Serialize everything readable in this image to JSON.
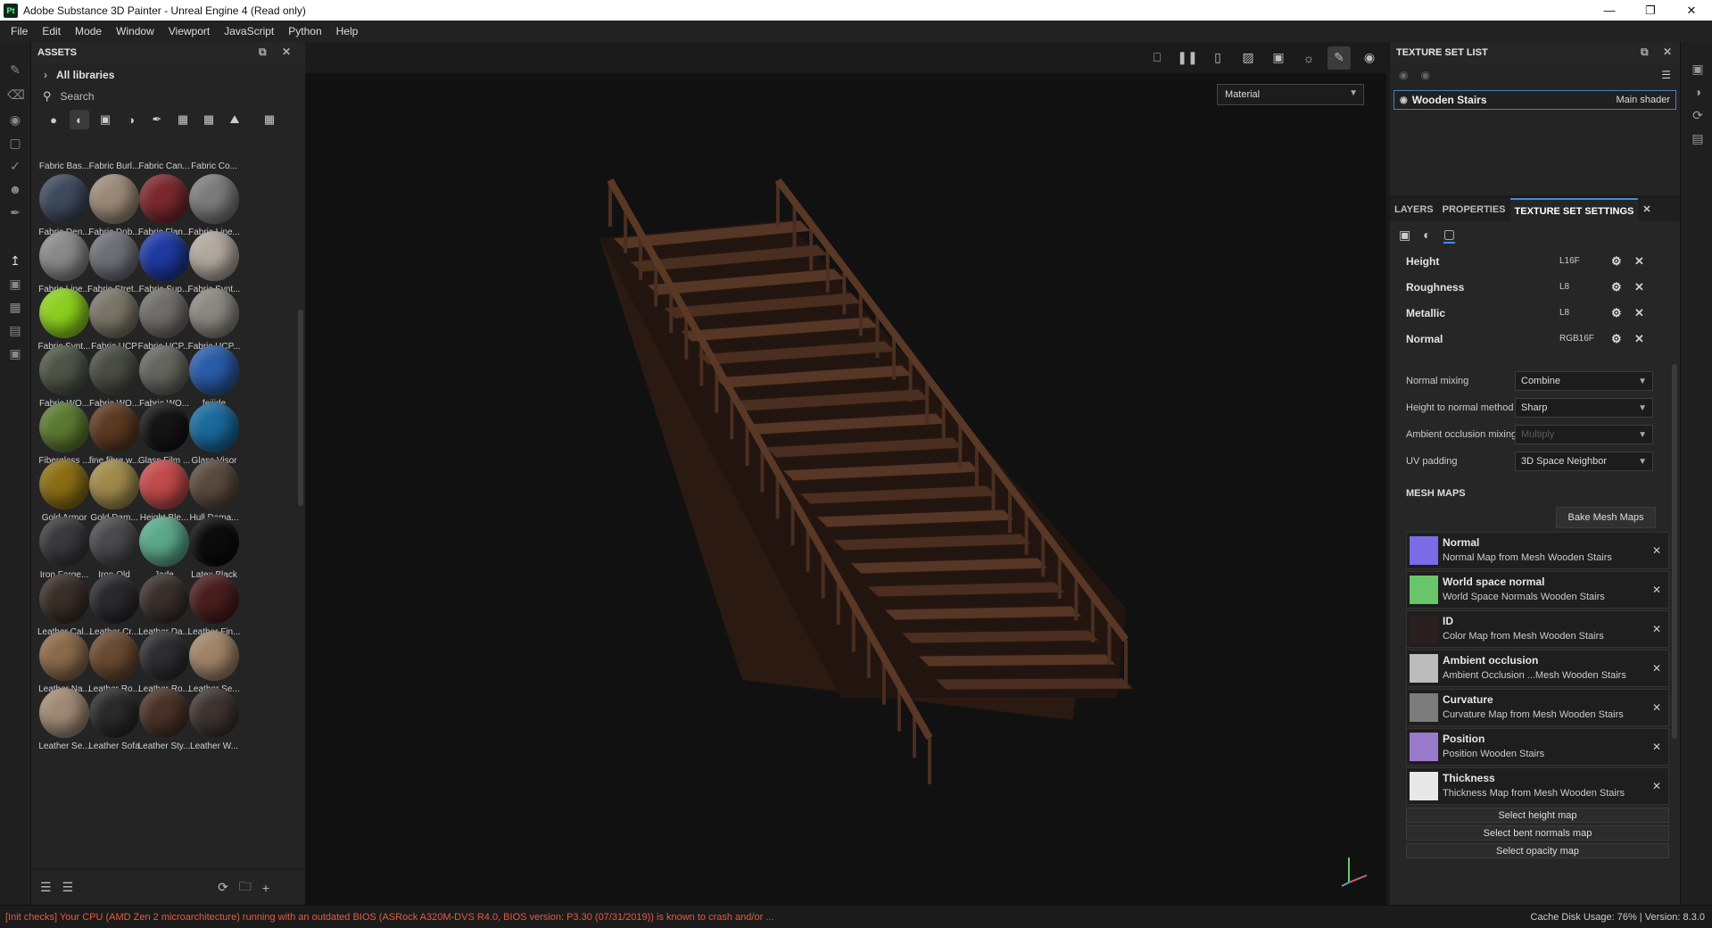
{
  "window": {
    "title": "Adobe Substance 3D Painter - Unreal Engine 4 (Read only)",
    "logo": "Pt"
  },
  "menu": [
    "File",
    "Edit",
    "Mode",
    "Window",
    "Viewport",
    "JavaScript",
    "Python",
    "Help"
  ],
  "assets": {
    "title": "ASSETS",
    "library": "All libraries",
    "search_placeholder": "Search",
    "top_labels": [
      "Fabric Bas...",
      "Fabric Burl...",
      "Fabric Can...",
      "Fabric Co..."
    ],
    "materials": [
      {
        "label": "Fabric Den...",
        "color": "#3e4a5c"
      },
      {
        "label": "Fabric Dob...",
        "color": "#9c8a78"
      },
      {
        "label": "Fabric Flan...",
        "color": "#7a2a2e"
      },
      {
        "label": "Fabric Line...",
        "color": "#7c7c7c"
      },
      {
        "label": "Fabric Line...",
        "color": "#8a8a8a"
      },
      {
        "label": "Fabric Stret...",
        "color": "#6d7078"
      },
      {
        "label": "Fabric Sup...",
        "color": "#1f3aa0"
      },
      {
        "label": "Fabric Synt...",
        "color": "#b1a89e"
      },
      {
        "label": "Fabric Synt...",
        "color": "#8ccf1e"
      },
      {
        "label": "Fabric UCP",
        "color": "#7a7568"
      },
      {
        "label": "Fabric UCP...",
        "color": "#6f6e6a"
      },
      {
        "label": "Fabric UCP...",
        "color": "#8a8880"
      },
      {
        "label": "Fabric WO...",
        "color": "#4e5648"
      },
      {
        "label": "Fabric WO...",
        "color": "#4a4d44"
      },
      {
        "label": "Fabric WO...",
        "color": "#666660"
      },
      {
        "label": "feijide",
        "color": "#2a5ca8"
      },
      {
        "label": "Fiberglass ...",
        "color": "#5c7a32"
      },
      {
        "label": "fine fibre w...",
        "color": "#5e3a22"
      },
      {
        "label": "Glass Film ...",
        "color": "#151515"
      },
      {
        "label": "Glass Visor",
        "color": "#1a6a9c"
      },
      {
        "label": "Gold Armor",
        "color": "#8a6e14"
      },
      {
        "label": "Gold Dam...",
        "color": "#a08a4a"
      },
      {
        "label": "Height Ble...",
        "color": "#c24a4a"
      },
      {
        "label": "Hull Dama...",
        "color": "#5a4a3e"
      },
      {
        "label": "Iron Forge...",
        "color": "#3a3a3c"
      },
      {
        "label": "Iron Old",
        "color": "#4a4a4c"
      },
      {
        "label": "Jade",
        "color": "#5aa88a"
      },
      {
        "label": "Latex Black",
        "color": "#0c0c0c"
      },
      {
        "label": "Leather Cal...",
        "color": "#3a2e28"
      },
      {
        "label": "Leather Cr...",
        "color": "#2a2a2c"
      },
      {
        "label": "Leather Da...",
        "color": "#3a302c"
      },
      {
        "label": "Leather Fin...",
        "color": "#4a1e1e"
      },
      {
        "label": "Leather Na...",
        "color": "#8a6a4a"
      },
      {
        "label": "Leather Ro...",
        "color": "#6a4a30"
      },
      {
        "label": "Leather Ro...",
        "color": "#2e2e30"
      },
      {
        "label": "Leather Se...",
        "color": "#a08468"
      },
      {
        "label": "Leather Se...",
        "color": "#a08a76"
      },
      {
        "label": "Leather Sofa",
        "color": "#2a2a2a"
      },
      {
        "label": "Leather Sty...",
        "color": "#4a3228"
      },
      {
        "label": "Leather W...",
        "color": "#3e3430"
      }
    ]
  },
  "viewport": {
    "mode_select": "Material"
  },
  "texture_set_list": {
    "title": "TEXTURE SET LIST",
    "set_name": "Wooden Stairs",
    "shader": "Main shader"
  },
  "tabs": [
    "LAYERS",
    "PROPERTIES",
    "TEXTURE SET SETTINGS"
  ],
  "channels": [
    {
      "name": "Height",
      "format": "L16F"
    },
    {
      "name": "Roughness",
      "format": "L8"
    },
    {
      "name": "Metallic",
      "format": "L8"
    },
    {
      "name": "Normal",
      "format": "RGB16F"
    }
  ],
  "options": [
    {
      "label": "Normal mixing",
      "value": "Combine",
      "disabled": false
    },
    {
      "label": "Height to normal method",
      "value": "Sharp",
      "disabled": false
    },
    {
      "label": "Ambient occlusion mixing",
      "value": "Multiply",
      "disabled": true
    },
    {
      "label": "UV padding",
      "value": "3D Space Neighbor",
      "disabled": false
    }
  ],
  "mesh_maps": {
    "title": "MESH MAPS",
    "bake_button": "Bake Mesh Maps",
    "items": [
      {
        "name": "Normal",
        "desc": "Normal Map from Mesh Wooden Stairs",
        "color": "#7a6ce8"
      },
      {
        "name": "World space normal",
        "desc": "World Space Normals Wooden Stairs",
        "color": "#6ac46a"
      },
      {
        "name": "ID",
        "desc": "Color Map from Mesh Wooden Stairs",
        "color": "#2a2020"
      },
      {
        "name": "Ambient occlusion",
        "desc": "Ambient Occlusion ...Mesh Wooden Stairs",
        "color": "#bcbcbc"
      },
      {
        "name": "Curvature",
        "desc": "Curvature Map from Mesh Wooden Stairs",
        "color": "#7c7c7c"
      },
      {
        "name": "Position",
        "desc": "Position Wooden Stairs",
        "color": "#9a7acc"
      },
      {
        "name": "Thickness",
        "desc": "Thickness Map from Mesh Wooden Stairs",
        "color": "#e8e8e8"
      }
    ],
    "select_buttons": [
      "Select height map",
      "Select bent normals map",
      "Select opacity map"
    ]
  },
  "status": {
    "warning": "[Init checks] Your CPU (AMD Zen 2 microarchitecture) running with an outdated BIOS (ASRock A320M-DVS R4.0, BIOS version: P3.30 (07/31/2019)) is known to crash and/or ...",
    "right": "Cache Disk Usage:   76% | Version: 8.3.0"
  },
  "colors": {
    "accent": "#3d8ee0",
    "warning": "#e35b3f"
  }
}
